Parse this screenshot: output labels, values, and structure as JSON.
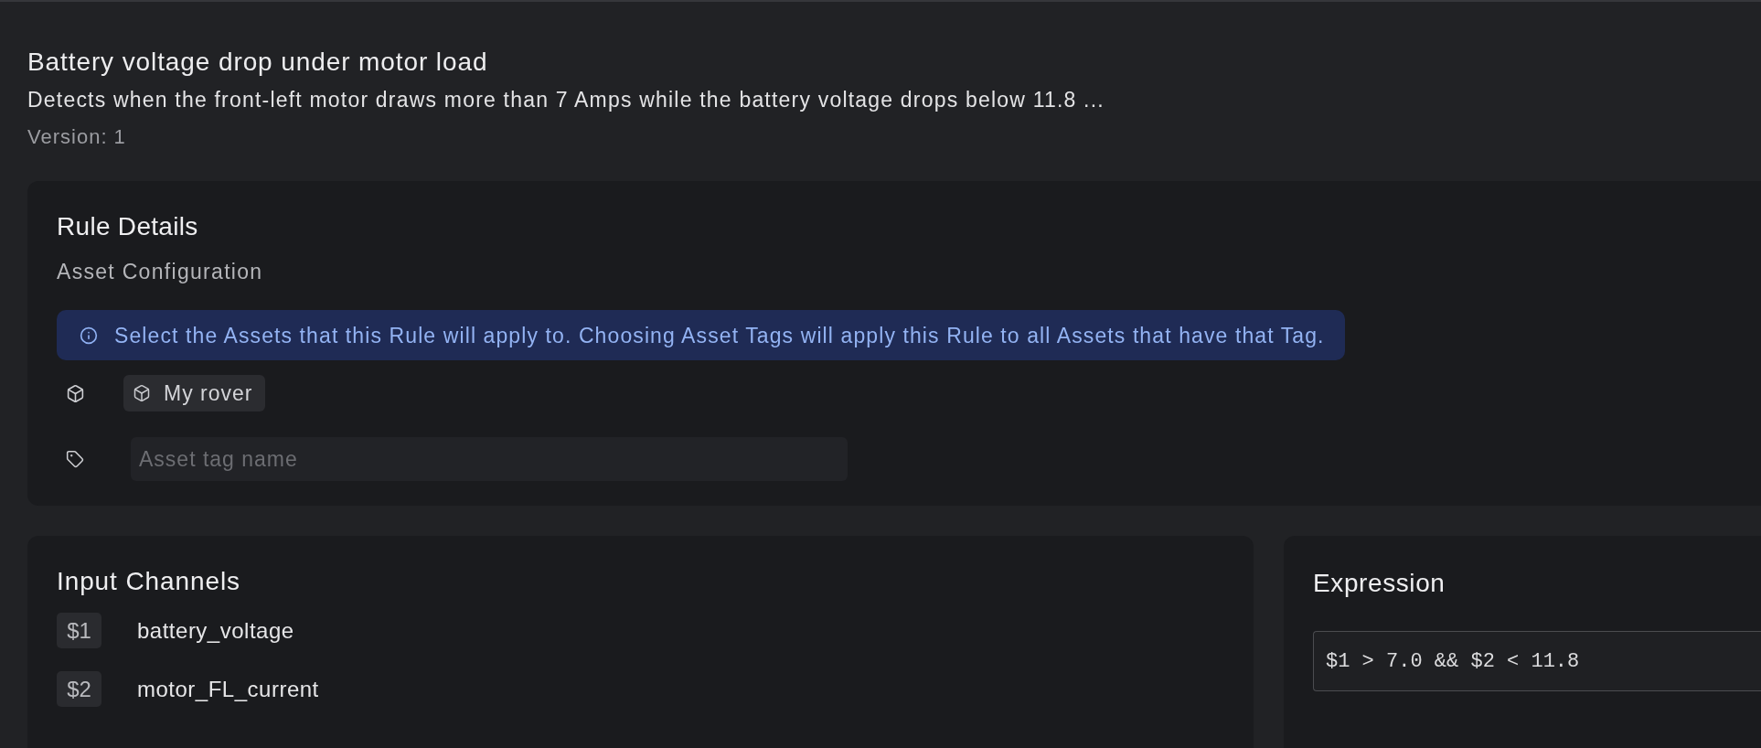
{
  "header": {
    "title": "Battery voltage drop under motor load",
    "description": "Detects when the front-left motor draws more than 7 Amps while the battery voltage drops below 11.8 ...",
    "version": "Version: 1"
  },
  "rule_details": {
    "title": "Rule Details",
    "subtitle": "Asset Configuration",
    "info": "Select the Assets that this Rule will apply to. Choosing Asset Tags will apply this Rule to all Assets that have that Tag.",
    "assets": [
      {
        "label": "My rover"
      }
    ],
    "tag_field": {
      "placeholder": "Asset tag name"
    }
  },
  "input_channels": {
    "title": "Input Channels",
    "channels": [
      {
        "variable": "$1",
        "name": "battery_voltage"
      },
      {
        "variable": "$2",
        "name": "motor_FL_current"
      }
    ]
  },
  "expression": {
    "title": "Expression",
    "value": "$1 > 7.0 && $2 < 11.8"
  }
}
